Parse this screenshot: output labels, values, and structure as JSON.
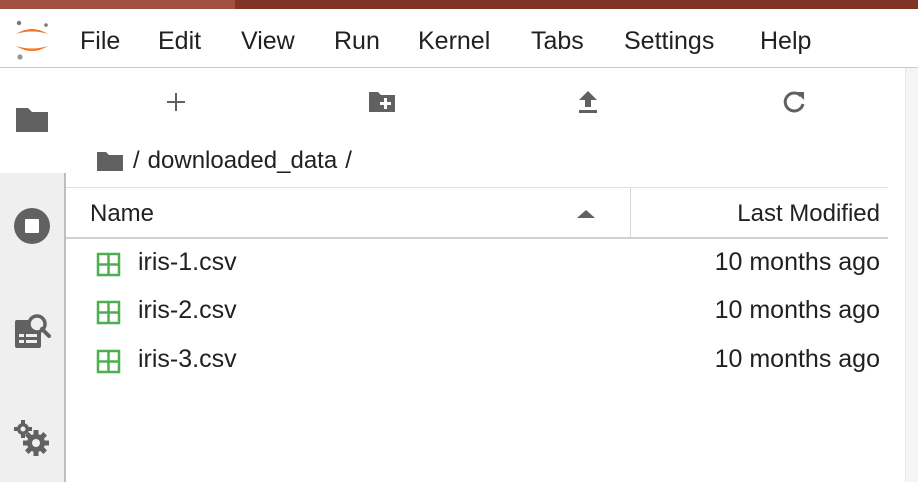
{
  "menubar": {
    "items": [
      "File",
      "Edit",
      "View",
      "Run",
      "Kernel",
      "Tabs",
      "Settings",
      "Help"
    ]
  },
  "sidebar": {
    "icons": [
      "folder-icon",
      "running-stop-icon",
      "property-inspector-icon",
      "extension-gears-icon"
    ]
  },
  "toolbar": {
    "icons": [
      "new-launcher-icon",
      "new-folder-icon",
      "upload-icon",
      "refresh-icon"
    ]
  },
  "breadcrumb": {
    "separator_root": "/",
    "folder": "downloaded_data",
    "separator_end": "/"
  },
  "file_list": {
    "col_name": "Name",
    "col_modified": "Last Modified",
    "sort": "ascending",
    "files": [
      {
        "name": "iris-1.csv",
        "modified": "10 months ago"
      },
      {
        "name": "iris-2.csv",
        "modified": "10 months ago"
      },
      {
        "name": "iris-3.csv",
        "modified": "10 months ago"
      }
    ]
  },
  "colors": {
    "accent_top": "#7f3424",
    "jupyter_orange": "#f37726",
    "csv_green": "#4caf50",
    "icon_gray": "#616161"
  }
}
